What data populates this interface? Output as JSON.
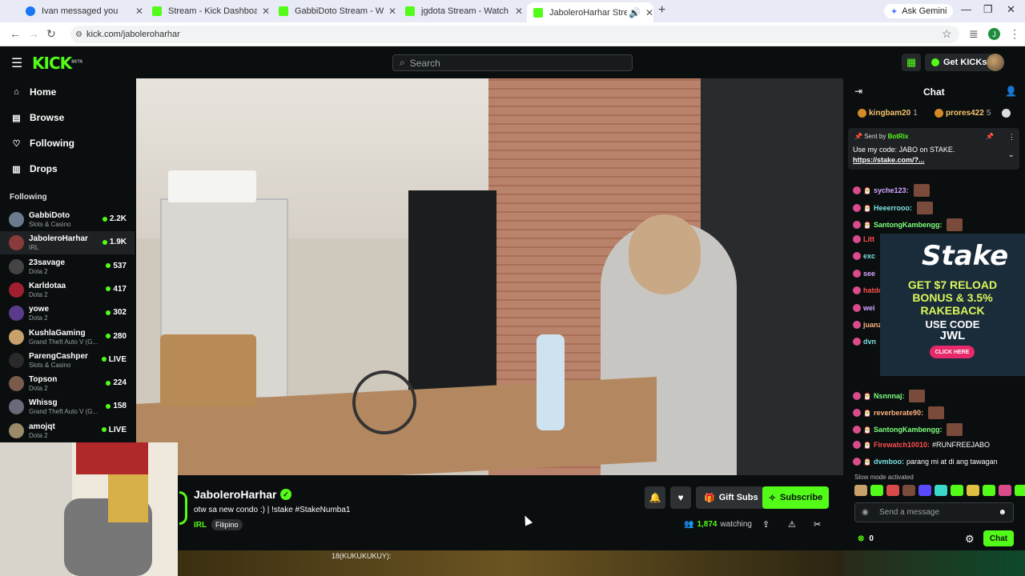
{
  "browser": {
    "tabs": [
      {
        "title": "Ivan messaged you",
        "color": "#1877f2"
      },
      {
        "title": "Stream - Kick Dashboard",
        "color": "#53fc18"
      },
      {
        "title": "GabbiDoto Stream - Watch Live",
        "color": "#53fc18"
      },
      {
        "title": "jgdota Stream - Watch Live on",
        "color": "#53fc18"
      },
      {
        "title": "JaboleroHarhar Stream - W",
        "color": "#53fc18"
      }
    ],
    "ask_gemini": "Ask Gemini",
    "url": "kick.com/jaboleroharhar",
    "profile_initial": "J"
  },
  "kick": {
    "logo": "KICK",
    "logo_beta": "BETA",
    "search_placeholder": "Search",
    "get_kicks": "Get KICKs"
  },
  "sidebar": {
    "nav": [
      {
        "label": "Home",
        "icon": "home-icon"
      },
      {
        "label": "Browse",
        "icon": "browse-icon"
      },
      {
        "label": "Following",
        "icon": "heart-icon"
      },
      {
        "label": "Drops",
        "icon": "drops-icon"
      }
    ],
    "following_heading": "Following",
    "channels": [
      {
        "name": "GabbiDoto",
        "category": "Slots & Casino",
        "viewers": "2.2K",
        "color": "#6b7a8f"
      },
      {
        "name": "JaboleroHarhar",
        "category": "IRL",
        "viewers": "1.9K",
        "color": "#8a3a3a"
      },
      {
        "name": "23savage",
        "category": "Dota 2",
        "viewers": "537",
        "color": "#444"
      },
      {
        "name": "Karldotaa",
        "category": "Dota 2",
        "viewers": "417",
        "color": "#a02030"
      },
      {
        "name": "yowe",
        "category": "Dota 2",
        "viewers": "302",
        "color": "#5a3a8a"
      },
      {
        "name": "KushlaGaming",
        "category": "Grand Theft Auto V (G...",
        "viewers": "280",
        "color": "#c9a26b"
      },
      {
        "name": "ParengCashper",
        "category": "Slots & Casino",
        "viewers": "LIVE",
        "color": "#2a2a2a"
      },
      {
        "name": "Topson",
        "category": "Dota 2",
        "viewers": "224",
        "color": "#7a5a4a"
      },
      {
        "name": "Whissg",
        "category": "Grand Theft Auto V (G...",
        "viewers": "158",
        "color": "#6a6a7a"
      },
      {
        "name": "amojqt",
        "category": "Dota 2",
        "viewers": "LIVE",
        "color": "#9a8a6a"
      }
    ]
  },
  "stream": {
    "streamer": "JaboleroHarhar",
    "title": "otw sa new condo :) | !stake #StakeNumba1",
    "category": "IRL",
    "tag": "Filipino",
    "gift_subs": "Gift Subs",
    "subscribe": "Subscribe",
    "viewers": "1,874",
    "watching_label": "watching",
    "bottom_overlay_text": "18(KUKUKUKUY):"
  },
  "chat": {
    "title": "Chat",
    "gifters": [
      {
        "name": "kingbam20",
        "count": "1"
      },
      {
        "name": "prores422",
        "count": "5"
      }
    ],
    "pinned": {
      "sent_by": "Sent by",
      "sender": "BotRix",
      "message": "Use my code: JABO on STAKE.",
      "link": "https://stake.com/?..."
    },
    "messages": [
      {
        "user": "syche123:",
        "text": "",
        "color": "#d6a6ff"
      },
      {
        "user": "Heeerrooo:",
        "text": "",
        "color": "#7ee0e0"
      },
      {
        "user": "SantongKambengg:",
        "text": "",
        "color": "#7eff7e"
      },
      {
        "user": "Nsnnnaj:",
        "text": "",
        "color": "#7eff7e"
      },
      {
        "user": "reverberate90:",
        "text": "",
        "color": "#ffb27e"
      },
      {
        "user": "SantongKambengg:",
        "text": "",
        "color": "#7eff7e"
      },
      {
        "user": "Firewatch10010:",
        "text": "#RUNFREEJABO",
        "color": "#ff4f4f"
      },
      {
        "user": "dvmboo:",
        "text": "parang mi at di ang tawagan",
        "color": "#7ee0e0"
      }
    ],
    "partial_users": [
      {
        "user": "Litt",
        "color": "#ff4f4f"
      },
      {
        "user": "exc",
        "color": "#7ee0e0"
      },
      {
        "user": "see",
        "color": "#d6a6ff"
      },
      {
        "user": "hatdog",
        "color": "#ff4f4f"
      },
      {
        "user": "wei",
        "color": "#d6a6ff"
      },
      {
        "user": "juanzki",
        "color": "#ffb27e"
      },
      {
        "user": "dvn",
        "color": "#7ee0e0"
      }
    ],
    "ad": {
      "brand": "Stake",
      "line1": "GET $7 RELOAD",
      "line2": "BONUS & 3.5%",
      "line3": "RAKEBACK",
      "line4": "USE CODE",
      "code": "JWL",
      "cta": "CLICK HERE"
    },
    "slow_mode": "Slow mode activated",
    "send_placeholder": "Send a message",
    "kicks_points": "0",
    "chat_button": "Chat"
  }
}
